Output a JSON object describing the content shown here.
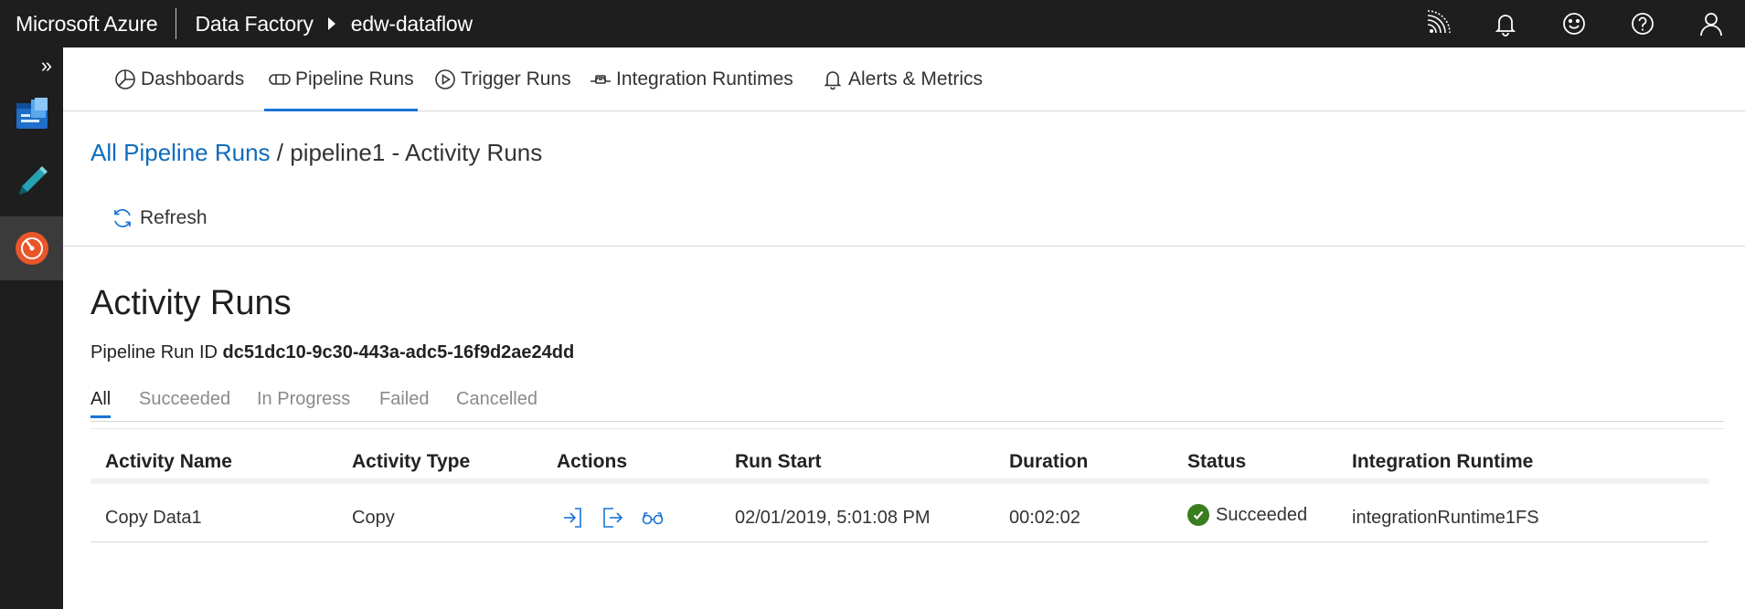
{
  "topbar": {
    "brand": "Microsoft Azure",
    "service": "Data Factory",
    "factory": "edw-dataflow",
    "icons": [
      "broadcast-icon",
      "bell-icon",
      "smiley-icon",
      "help-icon",
      "user-icon"
    ]
  },
  "rail": {
    "expand_label": "»",
    "items": [
      "overview-icon",
      "author-pencil-icon",
      "monitor-gauge-icon"
    ],
    "active_index": 2
  },
  "nav": {
    "tabs": [
      {
        "label": "Dashboards",
        "icon": "dashboard-icon"
      },
      {
        "label": "Pipeline Runs",
        "icon": "pipeline-icon"
      },
      {
        "label": "Trigger Runs",
        "icon": "play-circle-icon"
      },
      {
        "label": "Integration Runtimes",
        "icon": "integration-runtime-icon"
      },
      {
        "label": "Alerts & Metrics",
        "icon": "bell-icon"
      }
    ],
    "active": "Pipeline Runs"
  },
  "breadcrumb": {
    "link": "All Pipeline Runs",
    "rest": " / pipeline1 - Activity Runs"
  },
  "toolbar": {
    "refresh_label": "Refresh"
  },
  "section": {
    "title": "Activity Runs",
    "run_id_label": "Pipeline Run ID",
    "run_id_value": "dc51dc10-9c30-443a-adc5-16f9d2ae24dd"
  },
  "filters": [
    "All",
    "Succeeded",
    "In Progress",
    "Failed",
    "Cancelled"
  ],
  "active_filter": "All",
  "table": {
    "columns": [
      "Activity Name",
      "Activity Type",
      "Actions",
      "Run Start",
      "Duration",
      "Status",
      "Integration Runtime"
    ],
    "rows": [
      {
        "activity_name": "Copy Data1",
        "activity_type": "Copy",
        "actions": [
          "input-icon",
          "output-icon",
          "details-glasses-icon"
        ],
        "run_start": "02/01/2019, 5:01:08 PM",
        "duration": "00:02:02",
        "status": "Succeeded",
        "integration_runtime": "integrationRuntime1FS"
      }
    ]
  },
  "colors": {
    "accent": "#1a73d9",
    "link": "#0f6cbd",
    "chrome": "#1e1e1e",
    "success": "#3a7d1f"
  }
}
